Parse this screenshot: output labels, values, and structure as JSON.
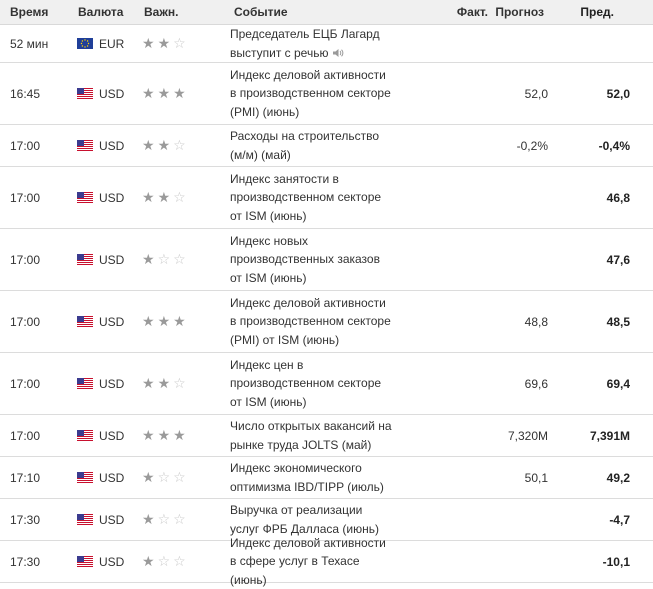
{
  "header": {
    "time": "Время",
    "currency": "Валюта",
    "importance": "Важн.",
    "event": "Событие",
    "actual": "Факт.",
    "forecast": "Прогноз",
    "previous": "Пред."
  },
  "rows": [
    {
      "time": "52 мин",
      "currency": "EUR",
      "flag": "eu-flag-icon",
      "importance": 2,
      "event": "Председатель ЕЦБ Лагард выступит с речью",
      "speech": true,
      "actual": "",
      "forecast": "",
      "previous": ""
    },
    {
      "time": "16:45",
      "currency": "USD",
      "flag": "us-flag-icon",
      "importance": 3,
      "event": "Индекс деловой активности в производственном секторе (PMI) (июнь)",
      "actual": "",
      "forecast": "52,0",
      "previous": "52,0"
    },
    {
      "time": "17:00",
      "currency": "USD",
      "flag": "us-flag-icon",
      "importance": 2,
      "event": "Расходы на строительство (м/м) (май)",
      "actual": "",
      "forecast": "-0,2%",
      "previous": "-0,4%"
    },
    {
      "time": "17:00",
      "currency": "USD",
      "flag": "us-flag-icon",
      "importance": 2,
      "event": "Индекс занятости в производственном секторе от ISM (июнь)",
      "actual": "",
      "forecast": "",
      "previous": "46,8"
    },
    {
      "time": "17:00",
      "currency": "USD",
      "flag": "us-flag-icon",
      "importance": 1,
      "event": "Индекс новых производственных заказов от ISM (июнь)",
      "actual": "",
      "forecast": "",
      "previous": "47,6"
    },
    {
      "time": "17:00",
      "currency": "USD",
      "flag": "us-flag-icon",
      "importance": 3,
      "event": "Индекс деловой активности в производственном секторе (PMI) от ISM (июнь)",
      "actual": "",
      "forecast": "48,8",
      "previous": "48,5"
    },
    {
      "time": "17:00",
      "currency": "USD",
      "flag": "us-flag-icon",
      "importance": 2,
      "event": "Индекс цен в производственном секторе от ISM (июнь)",
      "actual": "",
      "forecast": "69,6",
      "previous": "69,4"
    },
    {
      "time": "17:00",
      "currency": "USD",
      "flag": "us-flag-icon",
      "importance": 3,
      "event": "Число открытых вакансий на рынке труда JOLTS (май)",
      "actual": "",
      "forecast": "7,320M",
      "previous": "7,391M"
    },
    {
      "time": "17:10",
      "currency": "USD",
      "flag": "us-flag-icon",
      "importance": 1,
      "event": "Индекс экономического оптимизма IBD/TIPP (июль)",
      "actual": "",
      "forecast": "50,1",
      "previous": "49,2"
    },
    {
      "time": "17:30",
      "currency": "USD",
      "flag": "us-flag-icon",
      "importance": 1,
      "event": "Выручка от реализации услуг ФРБ Далласа (июнь)",
      "actual": "",
      "forecast": "",
      "previous": "-4,7"
    },
    {
      "time": "17:30",
      "currency": "USD",
      "flag": "us-flag-icon",
      "importance": 1,
      "event": "Индекс деловой активности в сфере услуг в Техасе (июнь)",
      "actual": "",
      "forecast": "",
      "previous": "-10,1"
    }
  ],
  "colors": {
    "header_bg": "#f0f0f0",
    "border": "#dcdcdc",
    "star_on": "#9a9a9a",
    "star_off": "#c9c9c9"
  }
}
